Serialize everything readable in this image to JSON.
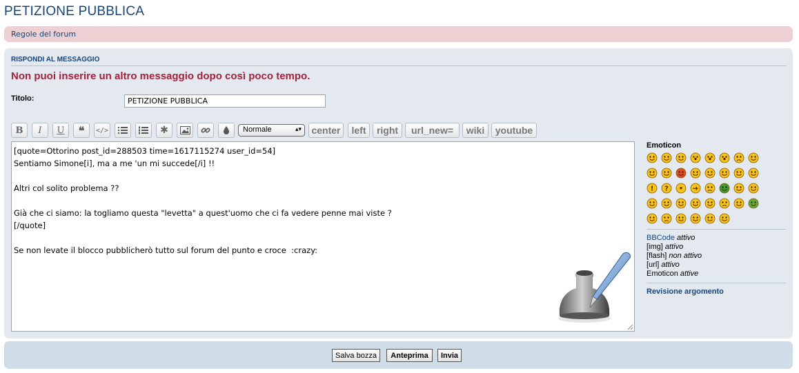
{
  "page": {
    "title": "PETIZIONE PUBBLICA"
  },
  "rules": {
    "link": "Regole del forum"
  },
  "reply": {
    "heading": "RISPONDI AL MESSAGGIO",
    "error": "Non puoi inserire un altro messaggio dopo così poco tempo.",
    "title_label": "Titolo:",
    "title_value": "PETIZIONE PUBBLICA"
  },
  "toolbar": {
    "icons": [
      "bold-icon",
      "italic-icon",
      "underline-icon",
      "quote-icon",
      "code-icon",
      "list-icon",
      "ordered-list-icon",
      "list-item-icon",
      "image-icon",
      "link-icon",
      "color-icon"
    ],
    "size_select": "Normale",
    "text_buttons": [
      "center",
      "left",
      "right",
      "url_new=",
      "wiki",
      "youtube"
    ]
  },
  "editor": {
    "lines": [
      "[quote=Ottorino post_id=288503 time=1617115274 user_id=54]",
      "Sentiamo Simone[i], ma a me 'un mi succede[/i] !!",
      "",
      "Altri col solito problema ??",
      "",
      "Già che ci siamo: la togliamo questa \"levetta\" a quest'uomo che ci fa vedere penne mai viste ?",
      "[/quote]",
      "",
      "Se non levate il blocco pubblicherò tutto sul forum del punto e croce  :crazy:"
    ]
  },
  "sidebar": {
    "emoticon_title": "Emoticon",
    "emoticons": [
      "laughing",
      "grin",
      "wink",
      "shy",
      "surprised",
      "eek",
      "confused",
      "cool",
      "tongue",
      "mad",
      "red-angry",
      "roll-eyes",
      "twisted",
      "evil",
      "smile-alt",
      "neutral-glasses",
      "exclaim",
      "question",
      "idea",
      "arrow",
      "sad",
      "green-grin",
      "geek",
      "nerd",
      "angry",
      "wave",
      "sleepy",
      "dunno",
      "whistle",
      "crying",
      "rolling",
      "sick",
      "blush",
      "ugh",
      "thumbs",
      "happy",
      "cheers",
      "meh"
    ],
    "bbcode_label": "BBCode",
    "bbcode_state": "attivo",
    "img_label": "[img]",
    "img_state": "attivo",
    "flash_label": "[flash]",
    "flash_state": "non attivo",
    "url_label": "[url]",
    "url_state": "attivo",
    "emoticon_label": "Emoticon",
    "emoticon_state": "attive",
    "revisione": "Revisione argomento"
  },
  "footer": {
    "save_draft": "Salva bozza",
    "preview": "Anteprima",
    "submit": "Invia"
  },
  "colors": {
    "title_blue": "#14457a",
    "error_red": "#a4213f",
    "rules_bg": "#ecd0d4",
    "panel_bg": "#e3e9ef",
    "footer_bg": "#cfdde9"
  }
}
